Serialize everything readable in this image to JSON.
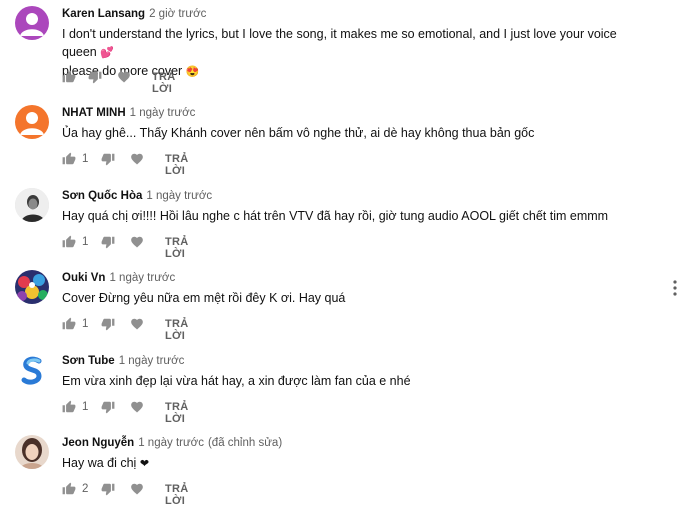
{
  "comments": [
    {
      "author": "Karen Lansang",
      "time": "2 giờ trước",
      "edited": "",
      "text_line1": "I don't understand the lyrics,  but I love the song, it makes me so emotional, and I just love your voice queen",
      "text_line1_emoji": "💕",
      "text_line2": "please do more cover",
      "text_line2_emoji": "😍",
      "likes": "",
      "reply_label": "TRẢ LỜI",
      "avatar": "purple-default-avatar"
    },
    {
      "author": "NHAT MINH",
      "time": "1 ngày trước",
      "edited": "",
      "text": "Ủa hay ghê... Thấy Khánh cover nên bấm vô nghe thử, ai dè hay không thua bản gốc",
      "likes": "1",
      "reply_label": "TRẢ LỜI",
      "avatar": "orange-default-avatar"
    },
    {
      "author": "Sơn Quốc Hòa",
      "time": "1 ngày trước",
      "edited": "",
      "text": "Hay quá chị ơi!!!! Hồi lâu nghe c hát trên VTV đã hay rồi, giờ tung audio AOOL giết chết tim emmm",
      "likes": "1",
      "reply_label": "TRẢ LỜI",
      "avatar": "bw-photo-avatar"
    },
    {
      "author": "Ouki Vn",
      "time": "1 ngày trước",
      "edited": "",
      "text": "Cover Đừng yêu nữa em mệt rồi đêy K ơi. Hay quá",
      "likes": "1",
      "reply_label": "TRẢ LỜI",
      "avatar": "colorful-group-avatar"
    },
    {
      "author": "Sơn Tube",
      "time": "1 ngày trước",
      "edited": "",
      "text": "Em vừa xinh đẹp lại vừa hát hay, a xin  được làm fan của e nhé",
      "likes": "1",
      "reply_label": "TRẢ LỜI",
      "avatar": "s-logo-avatar"
    },
    {
      "author": "Jeon Nguyễn",
      "time": "1 ngày trước",
      "edited": "(đã chỉnh sửa)",
      "text_line1": "Hay wa đi  chị",
      "text_line1_emoji": "❤",
      "likes": "2",
      "reply_label": "TRẢ LỜI",
      "avatar": "portrait-photo-avatar"
    }
  ],
  "colors": {
    "text": "#111111",
    "meta": "#606060",
    "icon": "#909090"
  }
}
